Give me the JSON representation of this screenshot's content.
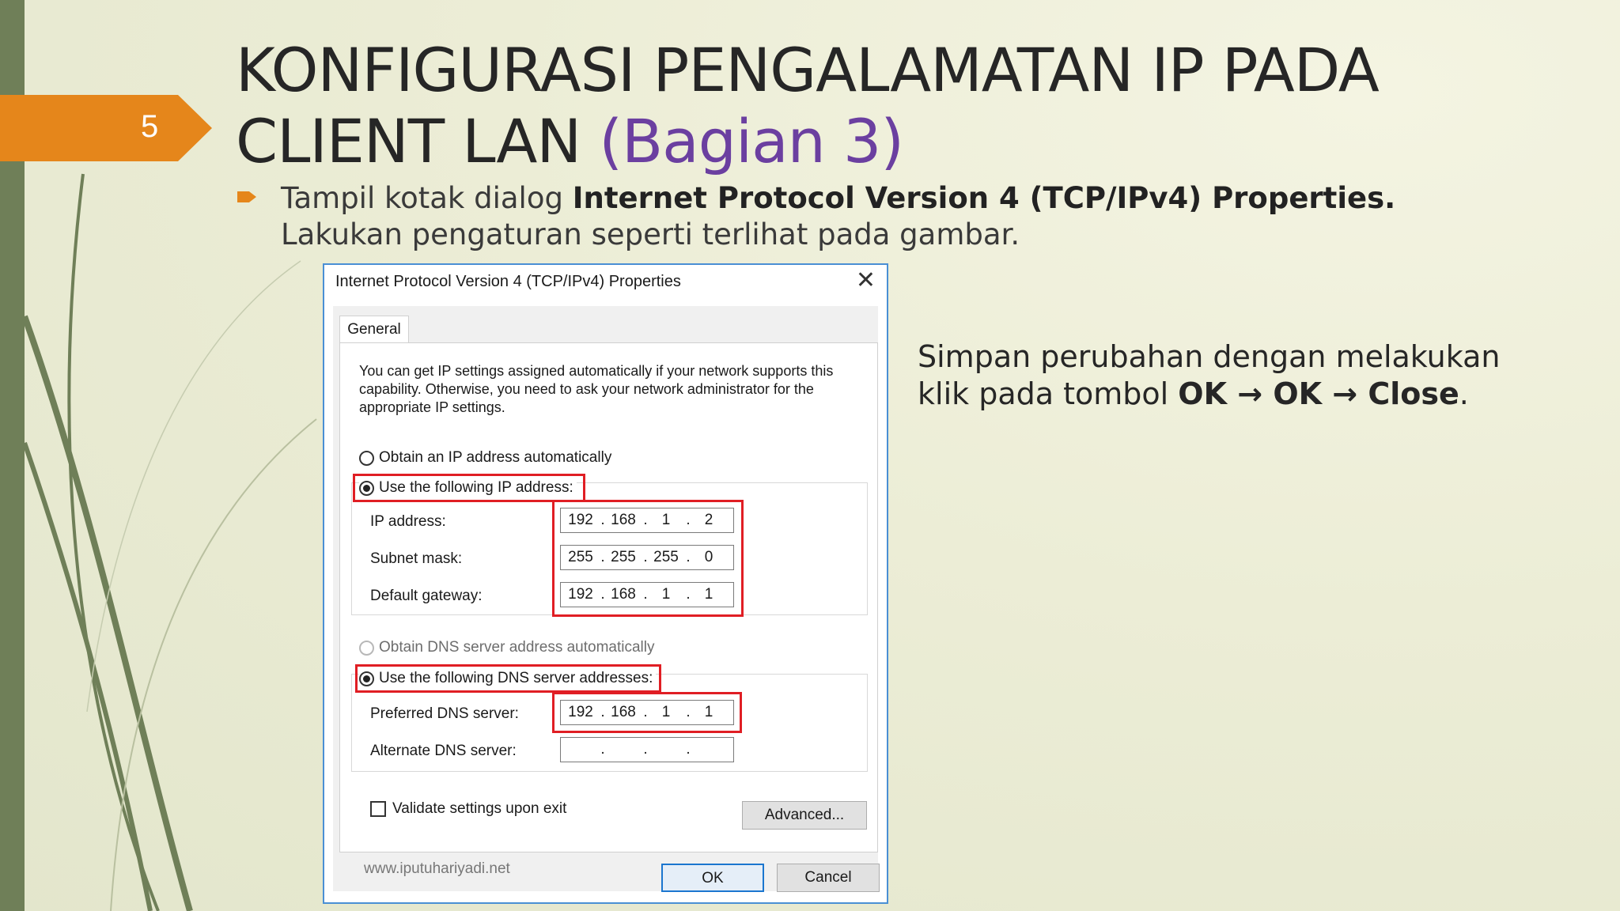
{
  "slide": {
    "number": "5",
    "title_line1": "KONFIGURASI PENGALAMATAN IP PADA",
    "title_line2": "CLIENT LAN",
    "title_accent": "(Bagian 3)",
    "bullet_pre": "Tampil kotak dialog ",
    "bullet_bold": "Internet Protocol Version 4 (TCP/IPv4) Properties.",
    "bullet_post": " Lakukan pengaturan seperti terlihat pada gambar.",
    "note_line1": "Simpan perubahan dengan melakukan",
    "note_pre": "klik pada tombol ",
    "note_bold": "OK → OK → Close",
    "note_end": ".",
    "accent_color": "#e5861b",
    "title_accent_color": "#6b3fa0"
  },
  "dialog": {
    "title": "Internet Protocol Version 4 (TCP/IPv4) Properties",
    "close_glyph": "✕",
    "tab_general": "General",
    "description": "You can get IP settings assigned automatically if your network supports this capability. Otherwise, you need to ask your network administrator for the appropriate IP settings.",
    "radio_auto_ip": "Obtain an IP address automatically",
    "radio_manual_ip": "Use the following IP address:",
    "ip_label": "IP address:",
    "ip_value": [
      "192",
      "168",
      "1",
      "2"
    ],
    "subnet_label": "Subnet mask:",
    "subnet_value": [
      "255",
      "255",
      "255",
      "0"
    ],
    "gateway_label": "Default gateway:",
    "gateway_value": [
      "192",
      "168",
      "1",
      "1"
    ],
    "radio_auto_dns": "Obtain DNS server address automatically",
    "radio_manual_dns": "Use the following DNS server addresses:",
    "preferred_dns_label": "Preferred DNS server:",
    "preferred_dns_value": [
      "192",
      "168",
      "1",
      "1"
    ],
    "alternate_dns_label": "Alternate DNS server:",
    "alternate_dns_value": [
      "",
      "",
      "",
      ""
    ],
    "validate_label": "Validate settings upon exit",
    "advanced_button": "Advanced...",
    "watermark": "www.iputuhariyadi.net",
    "ok_button": "OK",
    "cancel_button": "Cancel",
    "highlight_color": "#e01e24"
  }
}
